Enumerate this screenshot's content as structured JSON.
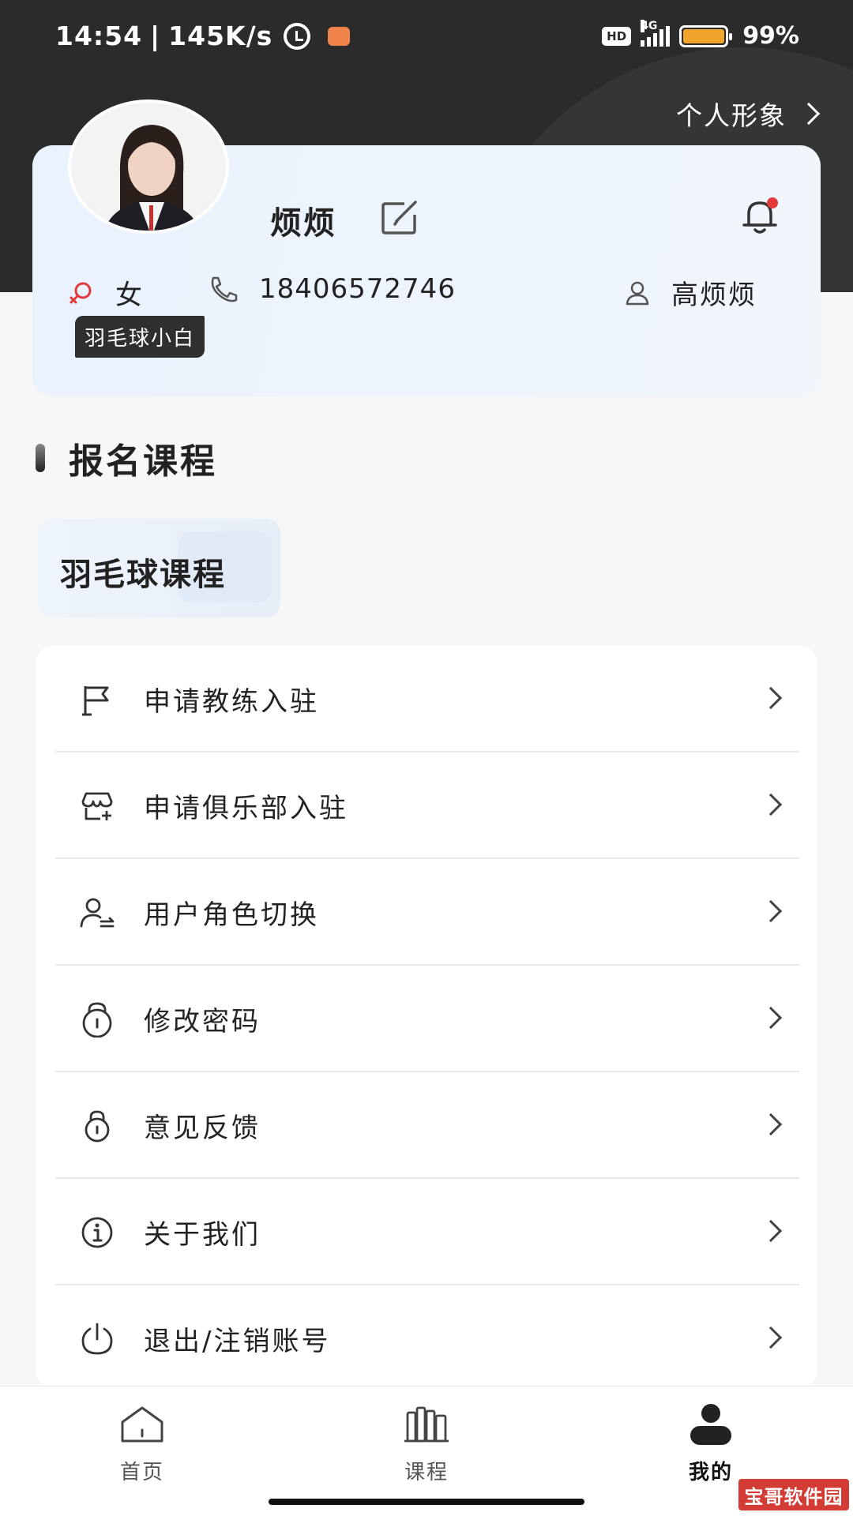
{
  "status_bar": {
    "time": "14:54",
    "speed": "145K/s",
    "hd": "HD",
    "network": "4G",
    "battery": "99%"
  },
  "header": {
    "persona_link": "个人形象"
  },
  "profile": {
    "name": "烦烦",
    "gender": "女",
    "phone": "18406572746",
    "real_name": "高烦烦",
    "badge": "羽毛球小白"
  },
  "enrolled": {
    "title": "报名课程",
    "courses": [
      "羽毛球课程"
    ]
  },
  "menu": [
    {
      "label": "申请教练入驻",
      "icon": "flag-icon"
    },
    {
      "label": "申请俱乐部入驻",
      "icon": "store-add-icon"
    },
    {
      "label": "用户角色切换",
      "icon": "user-switch-icon"
    },
    {
      "label": "修改密码",
      "icon": "lock-icon"
    },
    {
      "label": "意见反馈",
      "icon": "feedback-icon"
    },
    {
      "label": "关于我们",
      "icon": "info-icon"
    },
    {
      "label": "退出/注销账号",
      "icon": "power-icon"
    }
  ],
  "tabbar": [
    {
      "label": "首页",
      "icon": "home-icon",
      "active": false
    },
    {
      "label": "课程",
      "icon": "books-icon",
      "active": false
    },
    {
      "label": "我的",
      "icon": "profile-icon",
      "active": true
    }
  ],
  "watermark": "宝哥软件园",
  "colors": {
    "header_bg": "#2b2b2b",
    "card_bg": "#ebf3fd",
    "accent_red": "#e2393b",
    "battery": "#f1a52d"
  }
}
